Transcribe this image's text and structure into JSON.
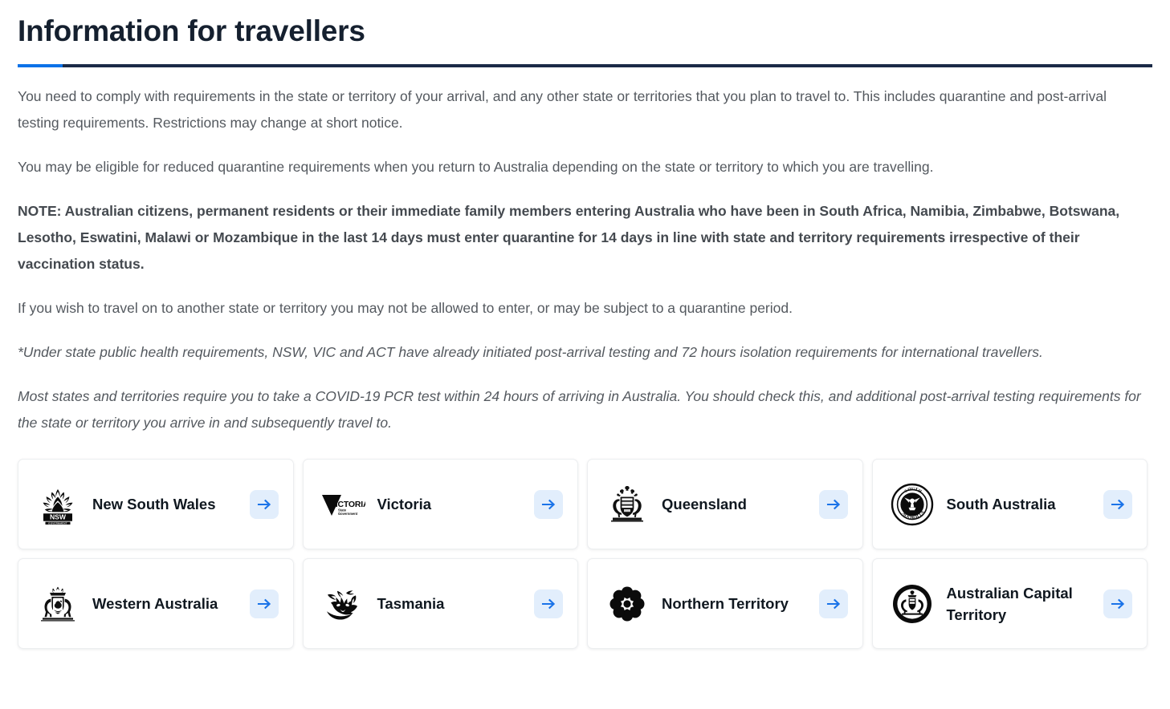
{
  "page": {
    "title": "Information for travellers"
  },
  "body": {
    "paragraphs": [
      {
        "style": "normal",
        "text": "You need to comply with requirements in the state or territory of your arrival, and any other state or territories that you plan to travel to. This includes quarantine and post-arrival testing requirements. Restrictions may change at short notice."
      },
      {
        "style": "normal",
        "text": "You may be eligible for reduced quarantine requirements when you return to Australia depending on the state or territory to which you are travelling."
      },
      {
        "style": "strong",
        "text": "NOTE: Australian citizens, permanent residents or their immediate family members entering Australia who have been in South Africa, Namibia, Zimbabwe, Botswana, Lesotho, Eswatini, Malawi or Mozambique in the last 14 days must enter quarantine for 14 days in line with state and territory requirements irrespective of their vaccination status."
      },
      {
        "style": "normal",
        "text": "If you wish to travel on to another state or territory you may not be allowed to enter, or may be subject to a quarantine period."
      },
      {
        "style": "italic",
        "text": "*Under state public health requirements, NSW, VIC and ACT have already initiated post-arrival testing and 72 hours isolation requirements for international travellers."
      },
      {
        "style": "italic",
        "text": "Most states and territories require you to take a COVID-19 PCR test within 24 hours of arriving in Australia. You should check this, and additional post-arrival testing requirements for the state or territory you arrive in and subsequently travel to."
      }
    ]
  },
  "cards": [
    {
      "label": "New South Wales",
      "logo": "nsw-government-waratah-logo",
      "arrow_label": "arrow-right"
    },
    {
      "label": "Victoria",
      "logo": "victoria-state-government-logo",
      "arrow_label": "arrow-right"
    },
    {
      "label": "Queensland",
      "logo": "queensland-coat-of-arms-logo",
      "arrow_label": "arrow-right"
    },
    {
      "label": "South Australia",
      "logo": "south-australia-piping-shrike-logo",
      "arrow_label": "arrow-right"
    },
    {
      "label": "Western Australia",
      "logo": "western-australia-coat-of-arms-logo",
      "arrow_label": "arrow-right"
    },
    {
      "label": "Tasmania",
      "logo": "tasmania-devil-logo",
      "arrow_label": "arrow-right"
    },
    {
      "label": "Northern Territory",
      "logo": "northern-territory-desert-rose-logo",
      "arrow_label": "arrow-right"
    },
    {
      "label": "Australian Capital Territory",
      "logo": "act-coat-of-arms-logo",
      "arrow_label": "arrow-right"
    }
  ],
  "colors": {
    "accent_blue": "#0b72e8",
    "rule_navy": "#1b2a47",
    "arrow_bg": "#e2eefc",
    "arrow_blue": "#1a73e8",
    "heading": "#15202f",
    "body_text": "#54595f"
  }
}
